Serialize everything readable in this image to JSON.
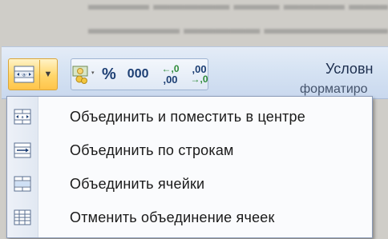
{
  "toolbar": {
    "percent_label": "%",
    "thousands_label": "000",
    "increase_decimal": {
      "top": "←,0",
      "bottom": ",00"
    },
    "decrease_decimal": {
      "top": ",00",
      "bottom": "→,0"
    },
    "conditional_label": "Условн",
    "conditional_sub": "форматиро"
  },
  "merge_menu": {
    "items": [
      {
        "label": "Объединить и поместить в центре",
        "icon": "merge-center-icon"
      },
      {
        "label": "Объединить по строкам",
        "icon": "merge-across-icon"
      },
      {
        "label": "Объединить ячейки",
        "icon": "merge-cells-icon"
      },
      {
        "label": "Отменить объединение ячеек",
        "icon": "unmerge-cells-icon"
      }
    ]
  },
  "colors": {
    "ribbon": "#d6e3f3",
    "active_button": "#ffd66b",
    "menu_background": "#fafbfd"
  }
}
